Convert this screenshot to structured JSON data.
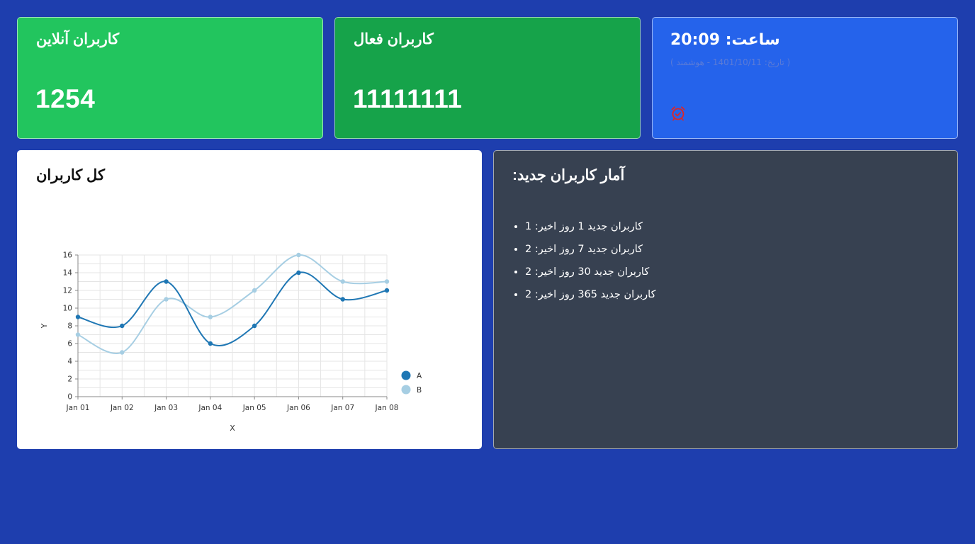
{
  "cards": {
    "online": {
      "title": "کاربران آنلاین",
      "value": "1254",
      "color": "#22c55e"
    },
    "active": {
      "title": "کاربران فعال",
      "value": "11111111",
      "color": "#16a34a"
    },
    "clock": {
      "title": "ساعت: 20:09",
      "date": "( تاریخ: 1401/10/11 - هوشمند )",
      "icon": "alarm-clock-icon",
      "icon_color": "#dc2626"
    }
  },
  "chart_panel": {
    "title": "کل کاربران"
  },
  "stats_panel": {
    "title": "آمار کاربران جدید:",
    "items": [
      "کاربران جدید 1 روز اخیر: 1",
      "کاربران جدید 7 روز اخیر: 2",
      "کاربران جدید 30 روز اخیر: 2",
      "کاربران جدید 365 روز اخیر: 2"
    ]
  },
  "chart_data": {
    "type": "line",
    "x": [
      "Jan 01",
      "Jan 02",
      "Jan 03",
      "Jan 04",
      "Jan 05",
      "Jan 06",
      "Jan 07",
      "Jan 08"
    ],
    "series": [
      {
        "name": "A",
        "values": [
          9,
          8,
          13,
          6,
          8,
          14,
          11,
          12
        ],
        "color": "#1f77b4"
      },
      {
        "name": "B",
        "values": [
          7,
          5,
          11,
          9,
          12,
          16,
          13,
          13
        ],
        "color": "#a6cee3"
      }
    ],
    "xlabel": "X",
    "ylabel": "Y",
    "ylim": [
      0,
      16
    ],
    "yticks": [
      0,
      2,
      4,
      6,
      8,
      10,
      12,
      14,
      16
    ],
    "grid": true,
    "legend": "right"
  },
  "colors": {
    "background": "#1e3eae",
    "stats_bg": "#374151"
  }
}
